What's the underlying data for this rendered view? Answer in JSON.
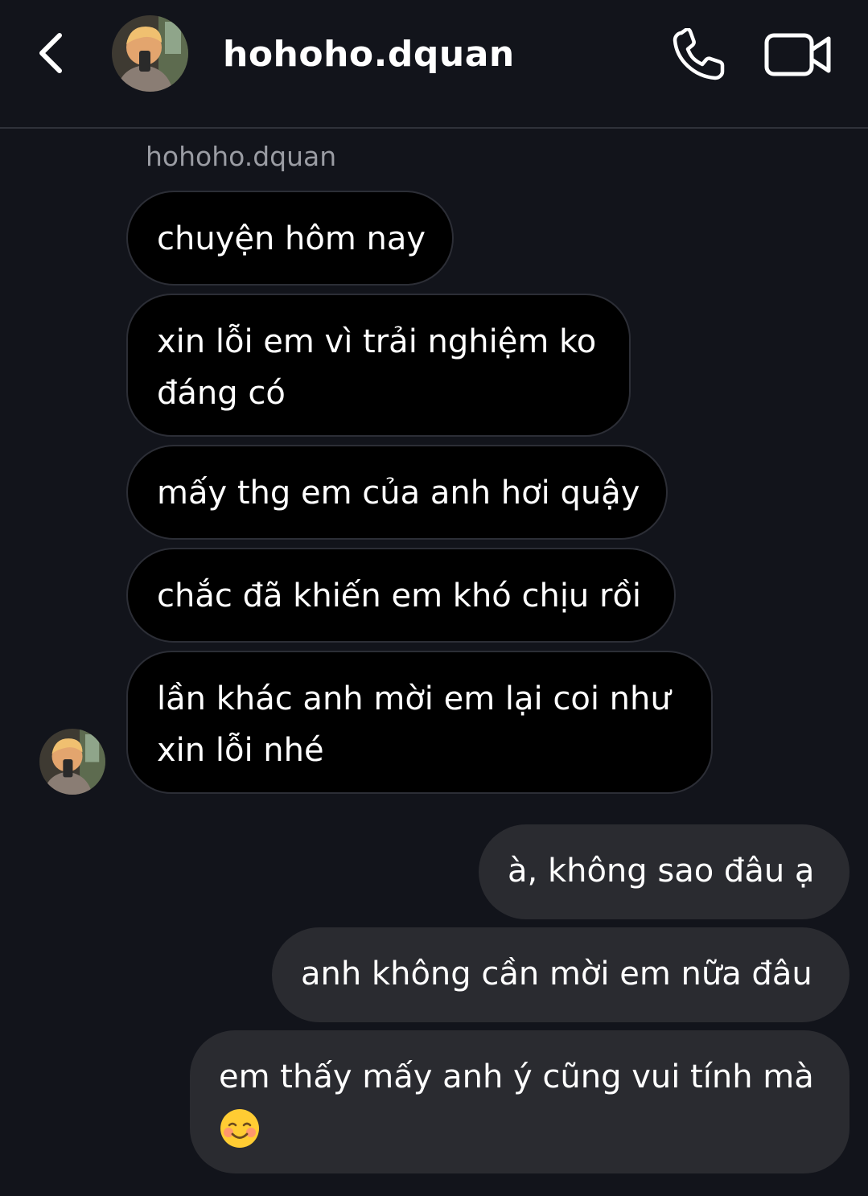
{
  "header": {
    "title": "hohoho.dquan",
    "back_icon": "chevron-left-icon",
    "call_icon": "phone-icon",
    "video_icon": "video-camera-icon"
  },
  "thread": {
    "sender_name": "hohoho.dquan",
    "incoming": [
      {
        "lines": [
          "chuyện hôm nay"
        ]
      },
      {
        "lines": [
          "xin lỗi em vì trải nghiệm ko",
          "đáng có"
        ]
      },
      {
        "lines": [
          "mấy thg em của anh hơi quậy"
        ]
      },
      {
        "lines": [
          "chắc đã khiến em khó chịu rồi"
        ]
      },
      {
        "lines": [
          "lần khác anh mời em lại coi như",
          "xin lỗi nhé"
        ]
      }
    ],
    "outgoing": [
      {
        "lines": [
          "à, không sao đâu ạ"
        ]
      },
      {
        "lines": [
          "anh không cần mời em nữa đâu"
        ]
      },
      {
        "lines": [
          "em thấy mấy anh ý cũng vui tính mà"
        ],
        "emoji": "smiling-face-emoji"
      }
    ]
  },
  "colors": {
    "background": "#12141b",
    "incoming_bubble": "#000000",
    "outgoing_bubble": "#2a2b30",
    "secondary_text": "#9a9ca3"
  }
}
